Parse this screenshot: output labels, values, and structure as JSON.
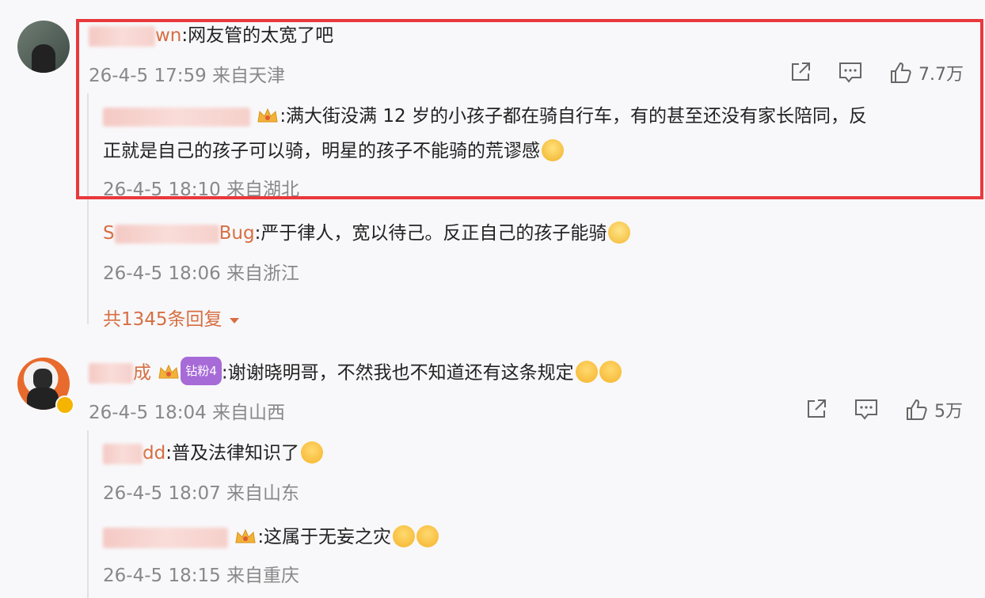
{
  "comments": [
    {
      "name_visible": "wn",
      "text": ":网友管的太宽了吧",
      "time": "26-4-5 17:59",
      "location": "来自天津",
      "likes": "7.7万",
      "replies": [
        {
          "text_line1": ":满大街没满 12 岁的小孩子都在骑自行车，有的甚至还没有家长陪同，反",
          "text_line2": "正就是自己的孩子可以骑，明星的孩子不能骑的荒谬感",
          "time": "26-4-5 18:10",
          "location": "来自湖北"
        },
        {
          "name_start": "S",
          "name_end": "Bug",
          "text": ":严于律人，宽以待己。反正自己的孩子能骑",
          "time": "26-4-5 18:06",
          "location": "来自浙江"
        }
      ],
      "more_replies": "共1345条回复"
    },
    {
      "name_visible": "成",
      "badge": "钻粉4",
      "text": ":谢谢晓明哥，不然我也不知道还有这条规定",
      "time": "26-4-5 18:04",
      "location": "来自山西",
      "likes": "5万",
      "replies": [
        {
          "name_end": "dd",
          "text": ":普及法律知识了",
          "time": "26-4-5 18:07",
          "location": "来自山东"
        },
        {
          "text": ":这属于无妄之灾",
          "time": "26-4-5 18:15",
          "location": "来自重庆"
        }
      ]
    }
  ]
}
